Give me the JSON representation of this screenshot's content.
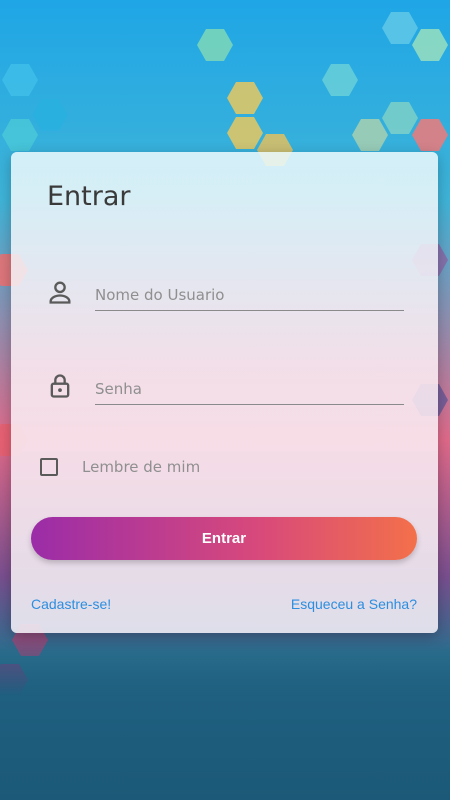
{
  "colors": {
    "accent_link": "#2d8ee0",
    "button_gradient_start": "#9b2ca8",
    "button_gradient_end": "#f3704a",
    "title_text": "#3a3a3a"
  },
  "login": {
    "title": "Entrar",
    "username": {
      "placeholder": "Nome do Usuario",
      "value": "",
      "icon": "person-icon"
    },
    "password": {
      "placeholder": "Senha",
      "value": "",
      "icon": "lock-icon"
    },
    "remember_label": "Lembre de mim",
    "remember_checked": false,
    "submit_label": "Entrar",
    "signup_link": "Cadastre-se!",
    "forgot_link": "Esqueceu a Senha?"
  }
}
